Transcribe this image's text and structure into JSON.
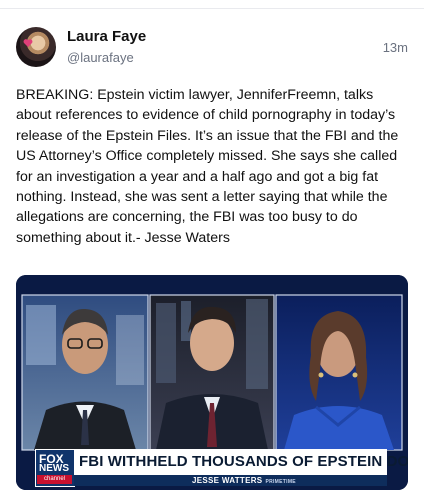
{
  "post": {
    "author_name": "Laura Faye",
    "author_handle": "@laurafaye",
    "timestamp": "13m",
    "body": "BREAKING: Epstein victim lawyer, JenniferFreemn, talks about references to evidence of child pornography in today’s release of the Epstein Files. It’s an issue that the FBI and the US Attorney’s Office completely missed. She says she called for an investigation a year and a half ago and got a big fat nothing. Instead, she was sent a letter saying that while the allegations are concerning, the FBI was too busy to do something about it.- Jesse Waters"
  },
  "media": {
    "network_logo_top": "FOX",
    "network_logo_mid": "NEWS",
    "network_logo_bot": "channel",
    "headline": "FBI WITHHELD THOUSANDS OF EPSTEIN DOCS",
    "show_name": "JESSE WATTERS",
    "show_tag": "PRIMETIME"
  },
  "colors": {
    "fox_blue": "#10346b",
    "fox_red": "#c8102e",
    "muted_text": "#6b7280"
  }
}
